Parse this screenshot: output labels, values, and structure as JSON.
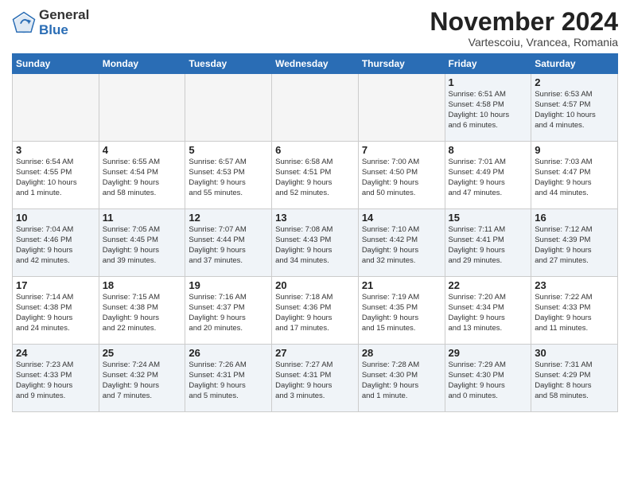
{
  "logo": {
    "general": "General",
    "blue": "Blue"
  },
  "title": "November 2024",
  "subtitle": "Vartescoiu, Vrancea, Romania",
  "days_of_week": [
    "Sunday",
    "Monday",
    "Tuesday",
    "Wednesday",
    "Thursday",
    "Friday",
    "Saturday"
  ],
  "weeks": [
    [
      {
        "day": "",
        "info": "",
        "empty": true
      },
      {
        "day": "",
        "info": "",
        "empty": true
      },
      {
        "day": "",
        "info": "",
        "empty": true
      },
      {
        "day": "",
        "info": "",
        "empty": true
      },
      {
        "day": "",
        "info": "",
        "empty": true
      },
      {
        "day": "1",
        "info": "Sunrise: 6:51 AM\nSunset: 4:58 PM\nDaylight: 10 hours\nand 6 minutes.",
        "empty": false
      },
      {
        "day": "2",
        "info": "Sunrise: 6:53 AM\nSunset: 4:57 PM\nDaylight: 10 hours\nand 4 minutes.",
        "empty": false
      }
    ],
    [
      {
        "day": "3",
        "info": "Sunrise: 6:54 AM\nSunset: 4:55 PM\nDaylight: 10 hours\nand 1 minute.",
        "empty": false
      },
      {
        "day": "4",
        "info": "Sunrise: 6:55 AM\nSunset: 4:54 PM\nDaylight: 9 hours\nand 58 minutes.",
        "empty": false
      },
      {
        "day": "5",
        "info": "Sunrise: 6:57 AM\nSunset: 4:53 PM\nDaylight: 9 hours\nand 55 minutes.",
        "empty": false
      },
      {
        "day": "6",
        "info": "Sunrise: 6:58 AM\nSunset: 4:51 PM\nDaylight: 9 hours\nand 52 minutes.",
        "empty": false
      },
      {
        "day": "7",
        "info": "Sunrise: 7:00 AM\nSunset: 4:50 PM\nDaylight: 9 hours\nand 50 minutes.",
        "empty": false
      },
      {
        "day": "8",
        "info": "Sunrise: 7:01 AM\nSunset: 4:49 PM\nDaylight: 9 hours\nand 47 minutes.",
        "empty": false
      },
      {
        "day": "9",
        "info": "Sunrise: 7:03 AM\nSunset: 4:47 PM\nDaylight: 9 hours\nand 44 minutes.",
        "empty": false
      }
    ],
    [
      {
        "day": "10",
        "info": "Sunrise: 7:04 AM\nSunset: 4:46 PM\nDaylight: 9 hours\nand 42 minutes.",
        "empty": false
      },
      {
        "day": "11",
        "info": "Sunrise: 7:05 AM\nSunset: 4:45 PM\nDaylight: 9 hours\nand 39 minutes.",
        "empty": false
      },
      {
        "day": "12",
        "info": "Sunrise: 7:07 AM\nSunset: 4:44 PM\nDaylight: 9 hours\nand 37 minutes.",
        "empty": false
      },
      {
        "day": "13",
        "info": "Sunrise: 7:08 AM\nSunset: 4:43 PM\nDaylight: 9 hours\nand 34 minutes.",
        "empty": false
      },
      {
        "day": "14",
        "info": "Sunrise: 7:10 AM\nSunset: 4:42 PM\nDaylight: 9 hours\nand 32 minutes.",
        "empty": false
      },
      {
        "day": "15",
        "info": "Sunrise: 7:11 AM\nSunset: 4:41 PM\nDaylight: 9 hours\nand 29 minutes.",
        "empty": false
      },
      {
        "day": "16",
        "info": "Sunrise: 7:12 AM\nSunset: 4:39 PM\nDaylight: 9 hours\nand 27 minutes.",
        "empty": false
      }
    ],
    [
      {
        "day": "17",
        "info": "Sunrise: 7:14 AM\nSunset: 4:38 PM\nDaylight: 9 hours\nand 24 minutes.",
        "empty": false
      },
      {
        "day": "18",
        "info": "Sunrise: 7:15 AM\nSunset: 4:38 PM\nDaylight: 9 hours\nand 22 minutes.",
        "empty": false
      },
      {
        "day": "19",
        "info": "Sunrise: 7:16 AM\nSunset: 4:37 PM\nDaylight: 9 hours\nand 20 minutes.",
        "empty": false
      },
      {
        "day": "20",
        "info": "Sunrise: 7:18 AM\nSunset: 4:36 PM\nDaylight: 9 hours\nand 17 minutes.",
        "empty": false
      },
      {
        "day": "21",
        "info": "Sunrise: 7:19 AM\nSunset: 4:35 PM\nDaylight: 9 hours\nand 15 minutes.",
        "empty": false
      },
      {
        "day": "22",
        "info": "Sunrise: 7:20 AM\nSunset: 4:34 PM\nDaylight: 9 hours\nand 13 minutes.",
        "empty": false
      },
      {
        "day": "23",
        "info": "Sunrise: 7:22 AM\nSunset: 4:33 PM\nDaylight: 9 hours\nand 11 minutes.",
        "empty": false
      }
    ],
    [
      {
        "day": "24",
        "info": "Sunrise: 7:23 AM\nSunset: 4:33 PM\nDaylight: 9 hours\nand 9 minutes.",
        "empty": false
      },
      {
        "day": "25",
        "info": "Sunrise: 7:24 AM\nSunset: 4:32 PM\nDaylight: 9 hours\nand 7 minutes.",
        "empty": false
      },
      {
        "day": "26",
        "info": "Sunrise: 7:26 AM\nSunset: 4:31 PM\nDaylight: 9 hours\nand 5 minutes.",
        "empty": false
      },
      {
        "day": "27",
        "info": "Sunrise: 7:27 AM\nSunset: 4:31 PM\nDaylight: 9 hours\nand 3 minutes.",
        "empty": false
      },
      {
        "day": "28",
        "info": "Sunrise: 7:28 AM\nSunset: 4:30 PM\nDaylight: 9 hours\nand 1 minute.",
        "empty": false
      },
      {
        "day": "29",
        "info": "Sunrise: 7:29 AM\nSunset: 4:30 PM\nDaylight: 9 hours\nand 0 minutes.",
        "empty": false
      },
      {
        "day": "30",
        "info": "Sunrise: 7:31 AM\nSunset: 4:29 PM\nDaylight: 8 hours\nand 58 minutes.",
        "empty": false
      }
    ]
  ]
}
